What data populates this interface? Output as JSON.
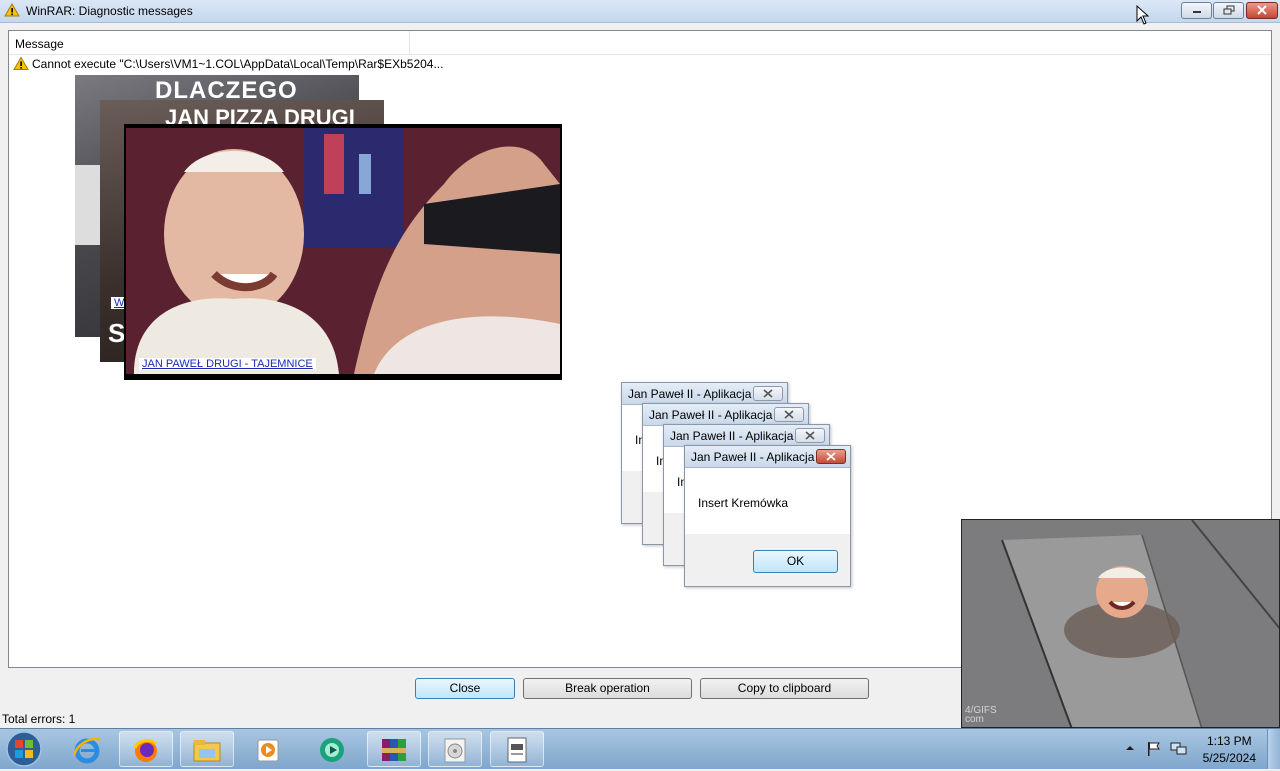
{
  "window": {
    "title": "WinRAR: Diagnostic messages",
    "min_icon": "minimize-icon",
    "max_icon": "restore-icon",
    "close_icon": "close-icon"
  },
  "list": {
    "header": "Message",
    "rows": [
      {
        "icon": "warning-icon",
        "text": "Cannot execute \"C:\\Users\\VM1~1.COL\\AppData\\Local\\Temp\\Rar$EXb5204..."
      }
    ]
  },
  "memes": [
    {
      "top_text": "DLACZEGO",
      "caption": "",
      "side_letter": ""
    },
    {
      "top_text": "JAN PIZZA DRUGI",
      "caption": "W",
      "side_letter": "S"
    },
    {
      "top_text": "",
      "caption": "JAN PAWEŁ DRUGI - TAJEMNICE",
      "side_letter": ""
    }
  ],
  "dialogs": [
    {
      "title": "Jan Paweł II - Aplikacja",
      "message": "In"
    },
    {
      "title": "Jan Paweł II - Aplikacja",
      "message": "In"
    },
    {
      "title": "Jan Paweł II - Aplikacja",
      "message": "In"
    },
    {
      "title": "Jan Paweł II - Aplikacja",
      "message": "Insert Kremówka",
      "ok": "OK"
    }
  ],
  "buttons": {
    "close": "Close",
    "break": "Break operation",
    "copy": "Copy to clipboard"
  },
  "status": "Total errors: 1",
  "video": {
    "watermark": "4/GIFS\ncom"
  },
  "taskbar": {
    "apps": [
      "internet-explorer-icon",
      "firefox-icon",
      "file-explorer-icon",
      "media-player-icon",
      "app-icon",
      "winrar-icon",
      "disc-icon",
      "document-icon"
    ],
    "time": "1:13 PM",
    "date": "5/25/2024"
  },
  "colors": {
    "accent": "#3c7fb1",
    "link": "#1a2bb0",
    "close_red": "#c54a34"
  }
}
